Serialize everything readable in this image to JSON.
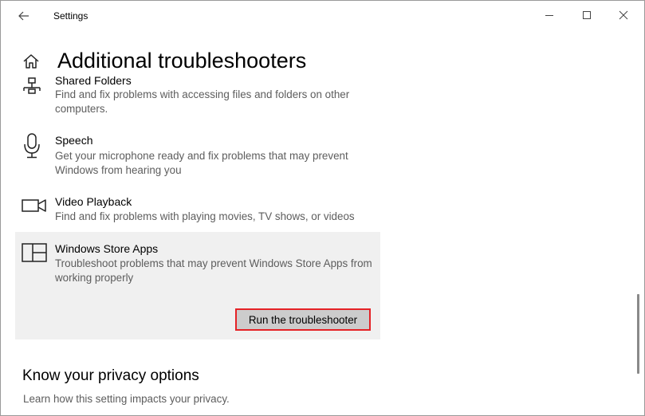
{
  "window": {
    "title": "Settings"
  },
  "page": {
    "title": "Additional troubleshooters"
  },
  "items": [
    {
      "name": "Shared Folders",
      "description": "Find and fix problems with accessing files and folders on other computers.",
      "icon": "shared-folders-icon"
    },
    {
      "name": "Speech",
      "description": "Get your microphone ready and fix problems that may prevent Windows from hearing you",
      "icon": "microphone-icon"
    },
    {
      "name": "Video Playback",
      "description": "Find and fix problems with playing movies, TV shows, or videos",
      "icon": "video-camera-icon"
    },
    {
      "name": "Windows Store Apps",
      "description": "Troubleshoot problems that may prevent Windows Store Apps from working properly",
      "icon": "store-apps-icon"
    }
  ],
  "run_button": {
    "label": "Run the troubleshooter",
    "highlight_color": "#e52226"
  },
  "privacy": {
    "title": "Know your privacy options",
    "subtitle": "Learn how this setting impacts your privacy."
  },
  "colors": {
    "selected_bg": "#f0f0f0",
    "button_bg": "#cccccc",
    "secondary_text": "#5d5d5d"
  }
}
